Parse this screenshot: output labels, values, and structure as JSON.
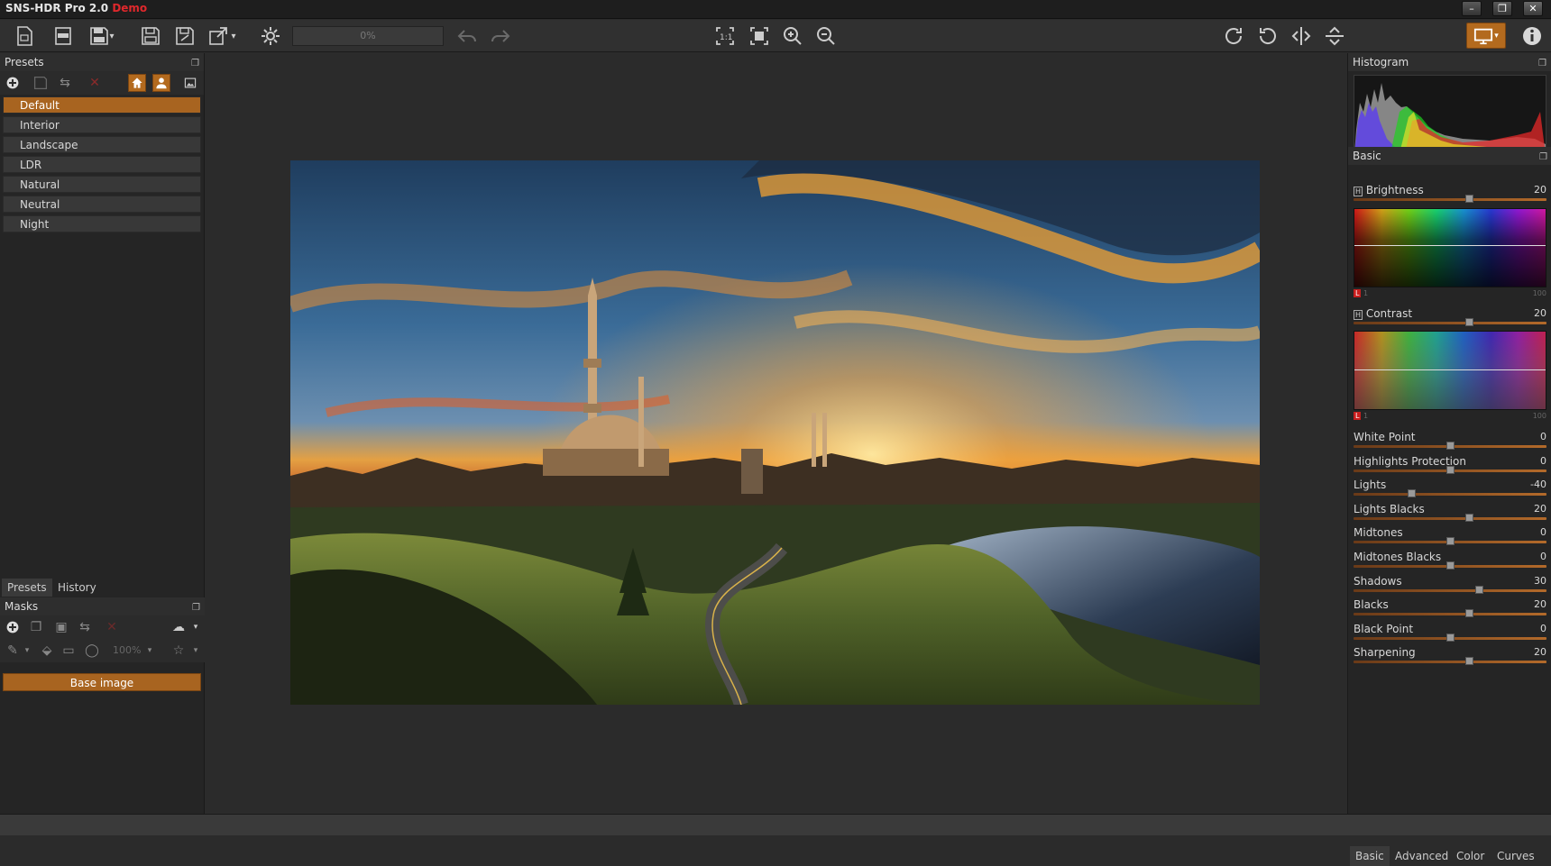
{
  "app": {
    "title": "SNS-HDR Pro 2.0",
    "badge": "Demo"
  },
  "window_controls": {
    "minimize": "–",
    "restore": "❐",
    "close": "✕"
  },
  "toolbar": {
    "progress": "0%"
  },
  "presets_panel": {
    "title": "Presets",
    "items": [
      {
        "label": "Default",
        "selected": true
      },
      {
        "label": "Interior"
      },
      {
        "label": "Landscape"
      },
      {
        "label": "LDR"
      },
      {
        "label": "Natural"
      },
      {
        "label": "Neutral"
      },
      {
        "label": "Night"
      }
    ],
    "tabs": [
      "Presets",
      "History"
    ]
  },
  "masks_panel": {
    "title": "Masks",
    "zoom": "100%",
    "base_image_label": "Base image"
  },
  "histogram_panel": {
    "title": "Histogram"
  },
  "basic_panel": {
    "title": "Basic",
    "brightness": {
      "label": "Brightness",
      "value": "20",
      "fraction": 0.6
    },
    "contrast": {
      "label": "Contrast",
      "value": "20",
      "fraction": 0.6
    },
    "swatch_scale": {
      "l": "L",
      "min": "1",
      "max": "100"
    },
    "sliders": [
      {
        "label": "White Point",
        "value": "0",
        "fraction": 0.5
      },
      {
        "label": "Highlights Protection",
        "value": "0",
        "fraction": 0.5
      },
      {
        "label": "Lights",
        "value": "-40",
        "fraction": 0.3
      },
      {
        "label": "Lights Blacks",
        "value": "20",
        "fraction": 0.6
      },
      {
        "label": "Midtones",
        "value": "0",
        "fraction": 0.5
      },
      {
        "label": "Midtones Blacks",
        "value": "0",
        "fraction": 0.5
      },
      {
        "label": "Shadows",
        "value": "30",
        "fraction": 0.65
      },
      {
        "label": "Blacks",
        "value": "20",
        "fraction": 0.6
      },
      {
        "label": "Black Point",
        "value": "0",
        "fraction": 0.5
      },
      {
        "label": "Sharpening",
        "value": "20",
        "fraction": 0.6
      }
    ]
  },
  "right_tabs": [
    "Basic",
    "Advanced",
    "Color",
    "Curves"
  ],
  "colors": {
    "accent": "#a86420",
    "demo": "#e0282c"
  }
}
